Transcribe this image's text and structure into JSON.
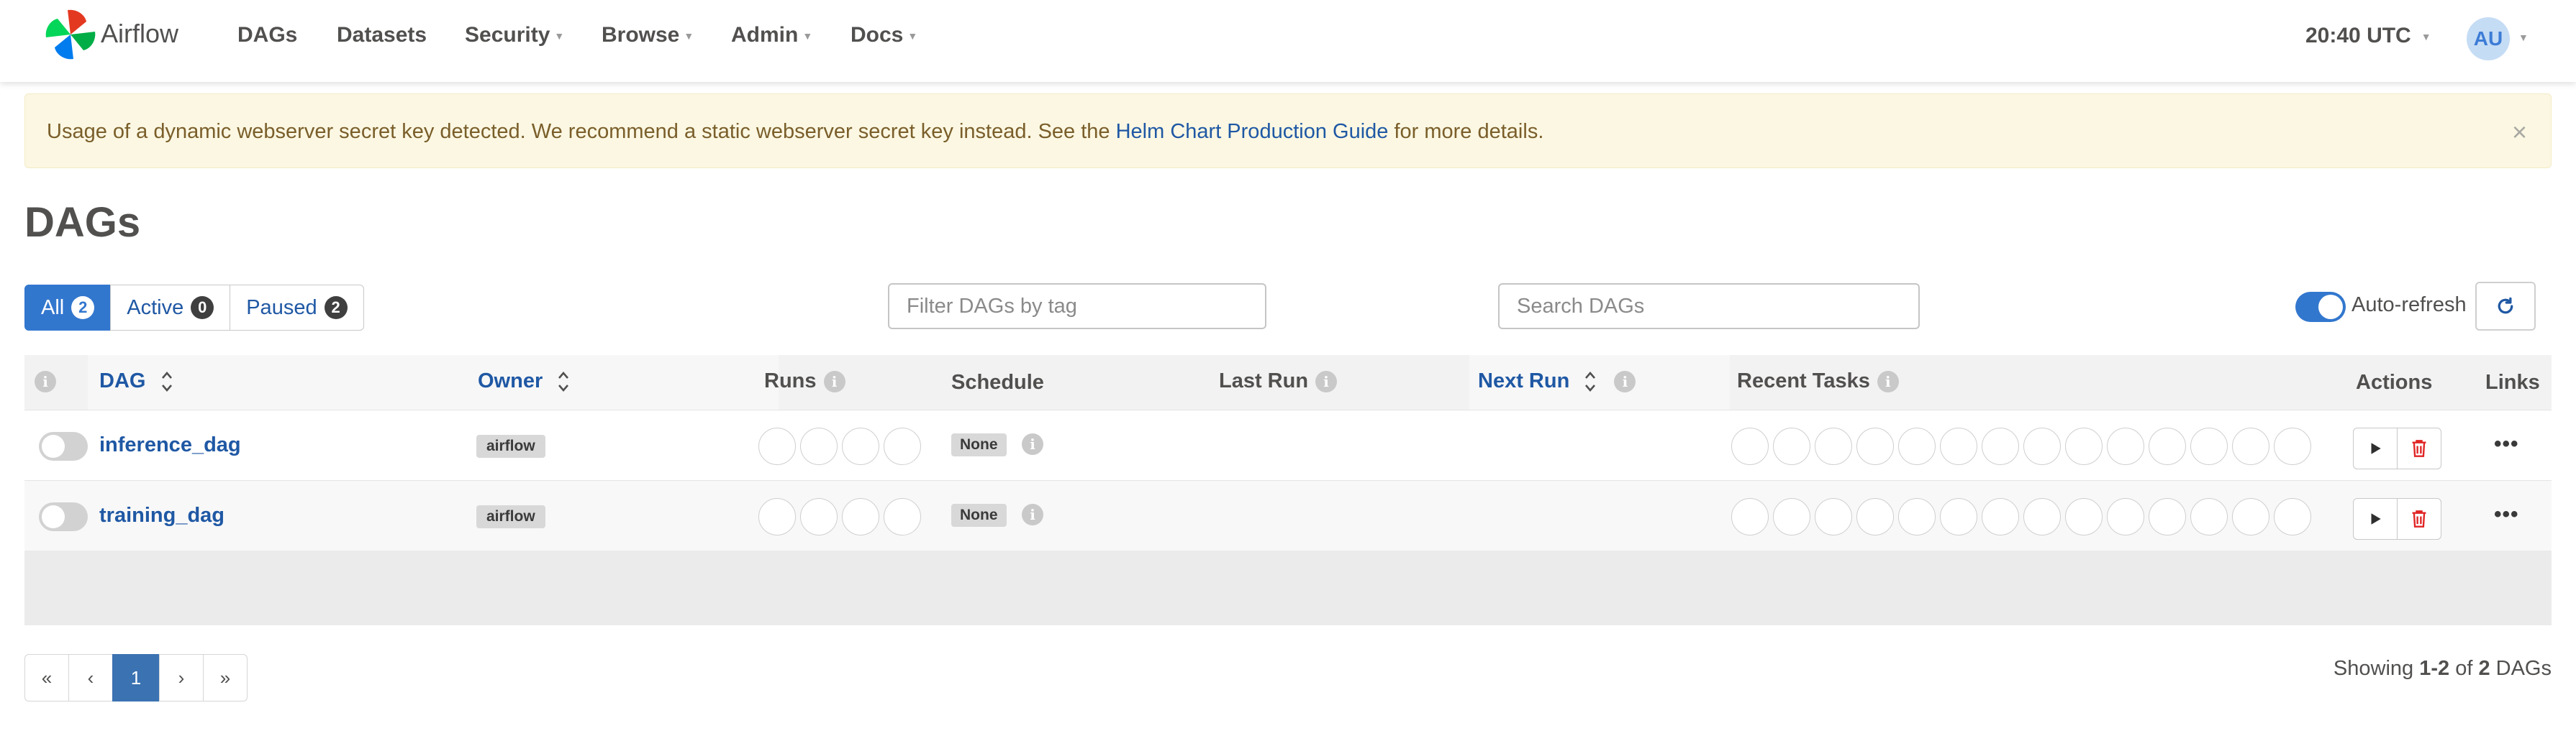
{
  "app": {
    "brand": "Airflow"
  },
  "nav": {
    "items": [
      {
        "label": "DAGs",
        "dropdown": false
      },
      {
        "label": "Datasets",
        "dropdown": false
      },
      {
        "label": "Security",
        "dropdown": true
      },
      {
        "label": "Browse",
        "dropdown": true
      },
      {
        "label": "Admin",
        "dropdown": true
      },
      {
        "label": "Docs",
        "dropdown": true
      }
    ],
    "clock": "20:40 UTC",
    "user_initials": "AU"
  },
  "alert": {
    "text_before": "Usage of a dynamic webserver secret key detected. We recommend a static webserver secret key instead. See the ",
    "link": "Helm Chart Production Guide",
    "text_after": " for more details.",
    "close": "×"
  },
  "page": {
    "title": "DAGs"
  },
  "filters": {
    "status": [
      {
        "label": "All",
        "count": "2",
        "active": true
      },
      {
        "label": "Active",
        "count": "0",
        "active": false
      },
      {
        "label": "Paused",
        "count": "2",
        "active": false
      }
    ],
    "tag_placeholder": "Filter DAGs by tag",
    "search_placeholder": "Search DAGs",
    "auto_refresh_label": "Auto-refresh",
    "auto_refresh_on": true
  },
  "table": {
    "headers": {
      "dag": "DAG",
      "owner": "Owner",
      "runs": "Runs",
      "schedule": "Schedule",
      "last_run": "Last Run",
      "next_run": "Next Run",
      "recent_tasks": "Recent Tasks",
      "actions": "Actions",
      "links": "Links"
    },
    "rows": [
      {
        "dag_id": "inference_dag",
        "owner": "airflow",
        "schedule": "None",
        "paused": true
      },
      {
        "dag_id": "training_dag",
        "owner": "airflow",
        "schedule": "None",
        "paused": true
      }
    ]
  },
  "pagination": {
    "first": "«",
    "prev": "‹",
    "current": "1",
    "next": "›",
    "last": "»",
    "showing_prefix": "Showing ",
    "range": "1-2",
    "of": " of ",
    "total": "2",
    "suffix": " DAGs"
  },
  "colors": {
    "primary": "#3277ce",
    "link": "#1f58a4",
    "alert_bg": "#fbf7e2",
    "text": "#51504f"
  },
  "icons": {
    "logo": "airflow-pinwheel-icon",
    "refresh": "refresh-icon",
    "info": "info-icon",
    "sort": "sort-icon",
    "trigger": "play-icon",
    "delete": "trash-icon",
    "links": "ellipsis-icon"
  }
}
